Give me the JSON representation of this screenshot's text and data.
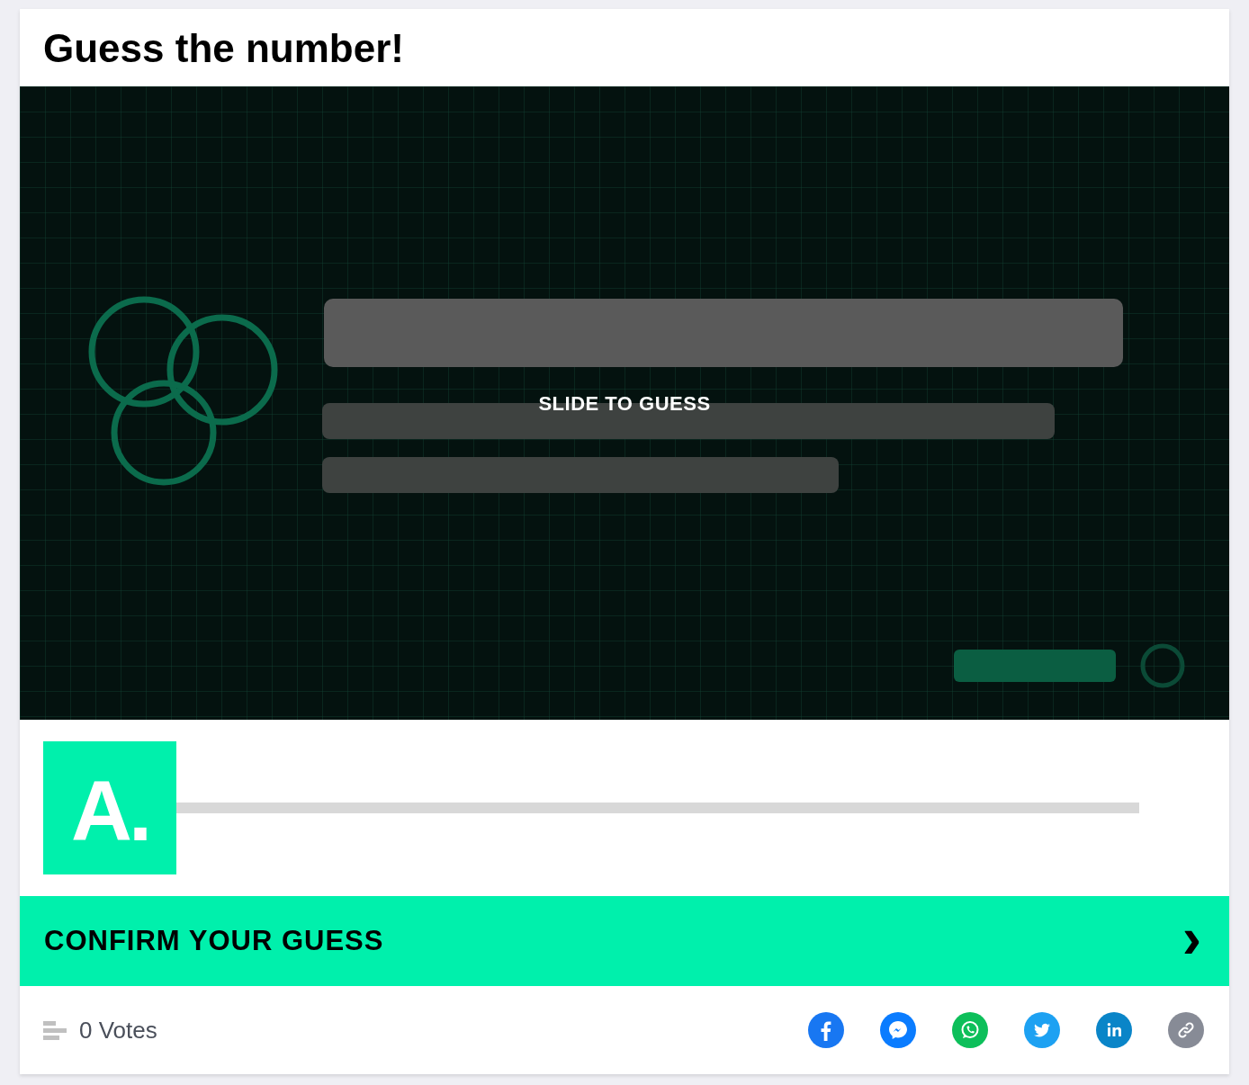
{
  "title": "Guess the number!",
  "media": {
    "kind": "picture",
    "overlay_text": "SLIDE TO GUESS"
  },
  "slider": {
    "thumb_label": "A.",
    "level": 0
  },
  "confirm_button": {
    "label": "CONFIRM YOUR GUESS",
    "chevron": "›"
  },
  "footer": {
    "votes": "0 Votes",
    "share": [
      {
        "kind": "facebook",
        "color": "#1877f2"
      },
      {
        "kind": "messenger",
        "color": "#0a7cff"
      },
      {
        "kind": "whatsapp",
        "color": "#0dbf5a"
      },
      {
        "kind": "twitter",
        "color": "#1da1f2"
      },
      {
        "kind": "linkedin",
        "color": "#0a85c8"
      },
      {
        "kind": "link",
        "color": "#878b96"
      }
    ]
  }
}
